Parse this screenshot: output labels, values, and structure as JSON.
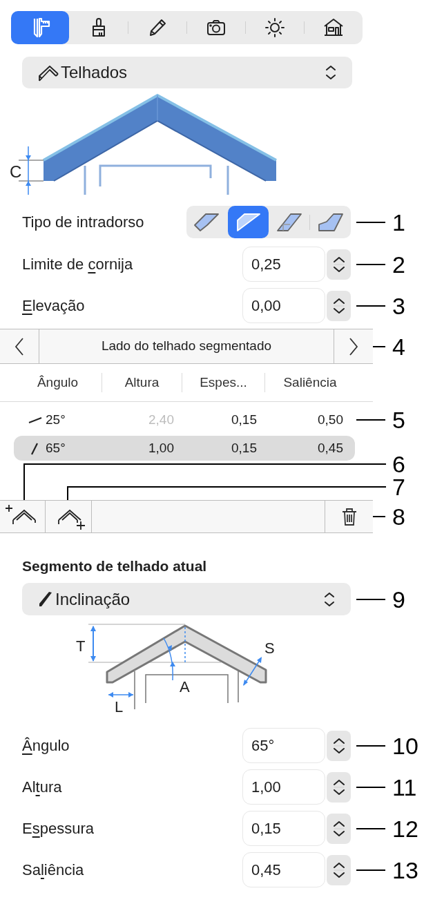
{
  "toolbar": {
    "tabs": [
      {
        "kind": "caliper",
        "selected": true
      },
      {
        "kind": "brush",
        "selected": false
      },
      {
        "kind": "pencil",
        "selected": false
      },
      {
        "kind": "camera",
        "selected": false
      },
      {
        "kind": "sun",
        "selected": false
      },
      {
        "kind": "house",
        "selected": false
      }
    ]
  },
  "category_dropdown": {
    "value": "Telhados"
  },
  "roof_diagram": {
    "label": "C"
  },
  "eave_type": {
    "label": "Tipo de intradorso",
    "callout": "1",
    "options": [
      {
        "kind": "plumb",
        "selected": false
      },
      {
        "kind": "square",
        "selected": true
      },
      {
        "kind": "level",
        "selected": false
      },
      {
        "kind": "boxed",
        "selected": false
      }
    ]
  },
  "roof_fields": [
    {
      "label": {
        "before": "Limite de ",
        "key": "c",
        "after": "ornija"
      },
      "value": "0,25",
      "callout": "2"
    },
    {
      "label": {
        "key": "E",
        "after": "levação"
      },
      "value": "0,00",
      "callout": "3"
    }
  ],
  "side_nav": {
    "title": "Lado do telhado segmentado",
    "callout": "4"
  },
  "table": {
    "columns": [
      "Ângulo",
      "Altura",
      "Espes...",
      "Saliência"
    ],
    "rows": [
      {
        "kind": "shallow",
        "selected": false,
        "callout": "5",
        "cells": [
          {
            "text": "25°",
            "dimmed": false
          },
          {
            "text": "2,40",
            "dimmed": true
          },
          {
            "text": "0,15",
            "dimmed": false
          },
          {
            "text": "0,50",
            "dimmed": false
          }
        ]
      },
      {
        "kind": "steep",
        "selected": true,
        "cells": [
          {
            "text": "65°",
            "dimmed": false
          },
          {
            "text": "1,00",
            "dimmed": false
          },
          {
            "text": "0,15",
            "dimmed": false
          },
          {
            "text": "0,45",
            "dimmed": false
          }
        ]
      }
    ]
  },
  "segment_buttons": [
    {
      "kind": "add-before",
      "callout": "6"
    },
    {
      "kind": "add-after",
      "callout": "7"
    },
    {
      "kind": "delete",
      "callout": "8"
    }
  ],
  "segment": {
    "title": "Segmento de telhado atual",
    "type_dropdown": {
      "value": "Inclinação",
      "callout": "9"
    },
    "diagram_labels": {
      "height": "T",
      "angle": "A",
      "thickness": "S",
      "overhang": "L"
    },
    "fields": [
      {
        "label": {
          "key": "Â",
          "after": "ngulo"
        },
        "value": "65°",
        "callout": "10"
      },
      {
        "label": {
          "before": "Al",
          "key": "t",
          "after": "ura"
        },
        "value": "1,00",
        "callout": "11"
      },
      {
        "label": {
          "before": "E",
          "key": "s",
          "after": "pessura"
        },
        "value": "0,15",
        "callout": "12"
      },
      {
        "label": {
          "before": "Sa",
          "key": "l",
          "after": "iência"
        },
        "value": "0,45",
        "callout": "13"
      }
    ]
  }
}
